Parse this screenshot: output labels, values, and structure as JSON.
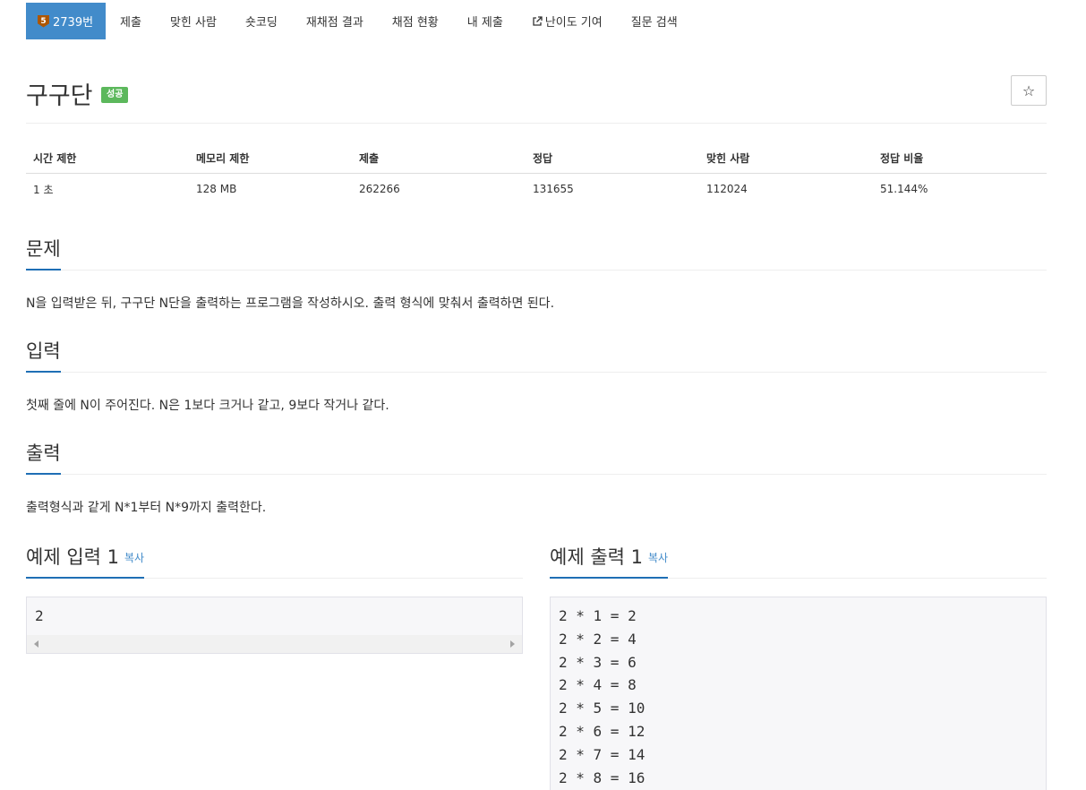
{
  "nav": {
    "problem_number": "2739번",
    "tier": "5",
    "tabs": [
      "제출",
      "맞힌 사람",
      "숏코딩",
      "재채점 결과",
      "채점 현황",
      "내 제출",
      "난이도 기여",
      "질문 검색"
    ]
  },
  "title": {
    "text": "구구단",
    "badge": "성공",
    "star": "☆"
  },
  "info": {
    "headers": [
      "시간 제한",
      "메모리 제한",
      "제출",
      "정답",
      "맞힌 사람",
      "정답 비율"
    ],
    "values": [
      "1 초",
      "128 MB",
      "262266",
      "131655",
      "112024",
      "51.144%"
    ]
  },
  "sections": {
    "problem": {
      "heading": "문제",
      "text": "N을 입력받은 뒤, 구구단 N단을 출력하는 프로그램을 작성하시오. 출력 형식에 맞춰서 출력하면 된다."
    },
    "input": {
      "heading": "입력",
      "text": "첫째 줄에 N이 주어진다. N은 1보다 크거나 같고, 9보다 작거나 같다."
    },
    "output": {
      "heading": "출력",
      "text": "출력형식과 같게 N*1부터 N*9까지 출력한다."
    }
  },
  "samples": {
    "input": {
      "heading": "예제 입력 1",
      "copy": "복사",
      "content": "2"
    },
    "output": {
      "heading": "예제 출력 1",
      "copy": "복사",
      "content": "2 * 1 = 2\n2 * 2 = 4\n2 * 3 = 6\n2 * 4 = 8\n2 * 5 = 10\n2 * 6 = 12\n2 * 7 = 14\n2 * 8 = 16"
    }
  },
  "colors": {
    "accent": "#428bca",
    "success": "#5cb85c",
    "tier_bronze": "#ad5600",
    "section_underline": "#1f6fb5"
  }
}
